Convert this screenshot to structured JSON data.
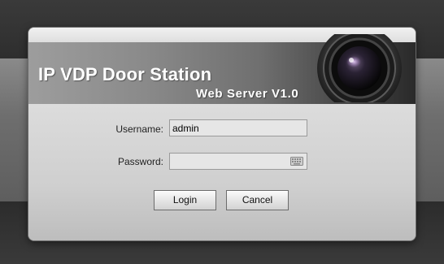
{
  "banner": {
    "title": "IP VDP Door Station",
    "subtitle": "Web Server V1.0"
  },
  "form": {
    "username_label": "Username:",
    "username_value": "admin",
    "password_label": "Password:",
    "password_value": ""
  },
  "buttons": {
    "login_label": "Login",
    "cancel_label": "Cancel"
  },
  "icons": {
    "camera": "camera-lens-icon",
    "keyboard": "keyboard-icon"
  }
}
